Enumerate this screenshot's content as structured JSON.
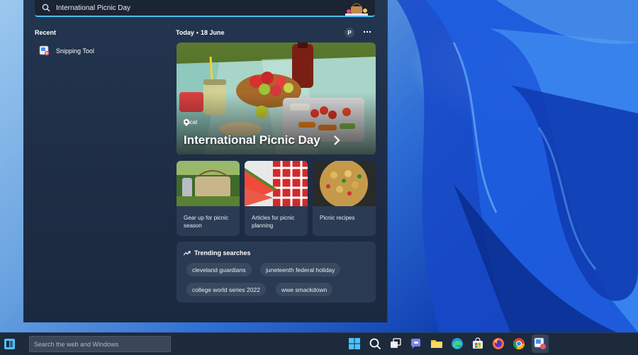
{
  "search": {
    "query": "International Picnic Day"
  },
  "recent": {
    "title": "Recent",
    "items": [
      {
        "label": "Snipping Tool",
        "icon": "snipping-tool-icon"
      }
    ]
  },
  "today": {
    "label": "Today",
    "separator": "•",
    "date": "18 June",
    "avatar_initial": "P"
  },
  "hero": {
    "tag": "Local",
    "title": "International Picnic Day"
  },
  "cards": [
    {
      "label": "Gear up for picnic season"
    },
    {
      "label": "Articles for picnic planning"
    },
    {
      "label": "Picnic recipes"
    }
  ],
  "trending": {
    "title": "Trending searches",
    "chips": [
      "cleveland guardians",
      "juneteenth federal holiday",
      "college world series 2022",
      "wwe smackdown"
    ]
  },
  "taskbar": {
    "search_placeholder": "Search the web and Windows",
    "apps": [
      "start",
      "search",
      "task-view",
      "teams",
      "file-explorer",
      "edge",
      "store",
      "firefox",
      "chrome",
      "snipping-tool"
    ]
  },
  "colors": {
    "accent": "#4cc2ff",
    "panel_bg": "#1e2d45",
    "card_bg": "#2b3b53",
    "taskbar_bg": "#1c2a3c"
  }
}
